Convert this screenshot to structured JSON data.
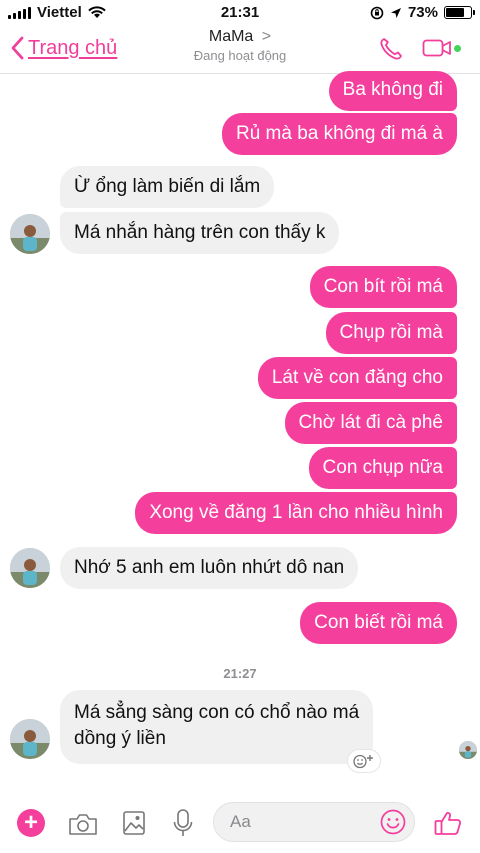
{
  "status_bar": {
    "carrier": "Viettel",
    "time": "21:31",
    "battery": "73%",
    "battery_level": 0.73
  },
  "header": {
    "back_label": "Trang chủ",
    "title": "MaMa",
    "title_chevron": ">",
    "subtitle": "Đang hoạt động"
  },
  "messages": [
    {
      "side": "out",
      "text": "Ba không đi"
    },
    {
      "side": "out",
      "text": "Rủ mà ba không đi má à"
    },
    {
      "side": "in",
      "text": "Ừ  ổng làm biến di lắm"
    },
    {
      "side": "in",
      "text": "Má nhắn hàng trên con thấy k"
    },
    {
      "side": "out",
      "text": "Con bít rồi má"
    },
    {
      "side": "out",
      "text": "Chụp rồi mà"
    },
    {
      "side": "out",
      "text": "Lát về con đăng cho"
    },
    {
      "side": "out",
      "text": "Chờ lát đi cà phê"
    },
    {
      "side": "out",
      "text": "Con chụp nữa"
    },
    {
      "side": "out",
      "text": "Xong về đăng 1 lần cho nhiều hình"
    },
    {
      "side": "in",
      "text": "Nhớ 5 anh em luôn nhứt dô nan"
    },
    {
      "side": "out",
      "text": "Con biết rồi má"
    },
    {
      "side": "in",
      "text": "Má sẳng sàng con có chổ nào má\ndồng ý liền"
    }
  ],
  "timestamp": "21:27",
  "composer": {
    "placeholder": "Aa"
  },
  "colors": {
    "accent": "#f43f9d",
    "incoming_bubble": "#f0f0f0",
    "online": "#44d35b"
  },
  "icons": [
    "signal-icon",
    "wifi-icon",
    "lock-rotation-icon",
    "location-icon",
    "battery-icon",
    "back-chevron-icon",
    "phone-icon",
    "video-camera-icon",
    "plus-icon",
    "camera-icon",
    "image-icon",
    "microphone-icon",
    "emoji-icon",
    "thumbs-up-icon",
    "add-reaction-icon"
  ]
}
